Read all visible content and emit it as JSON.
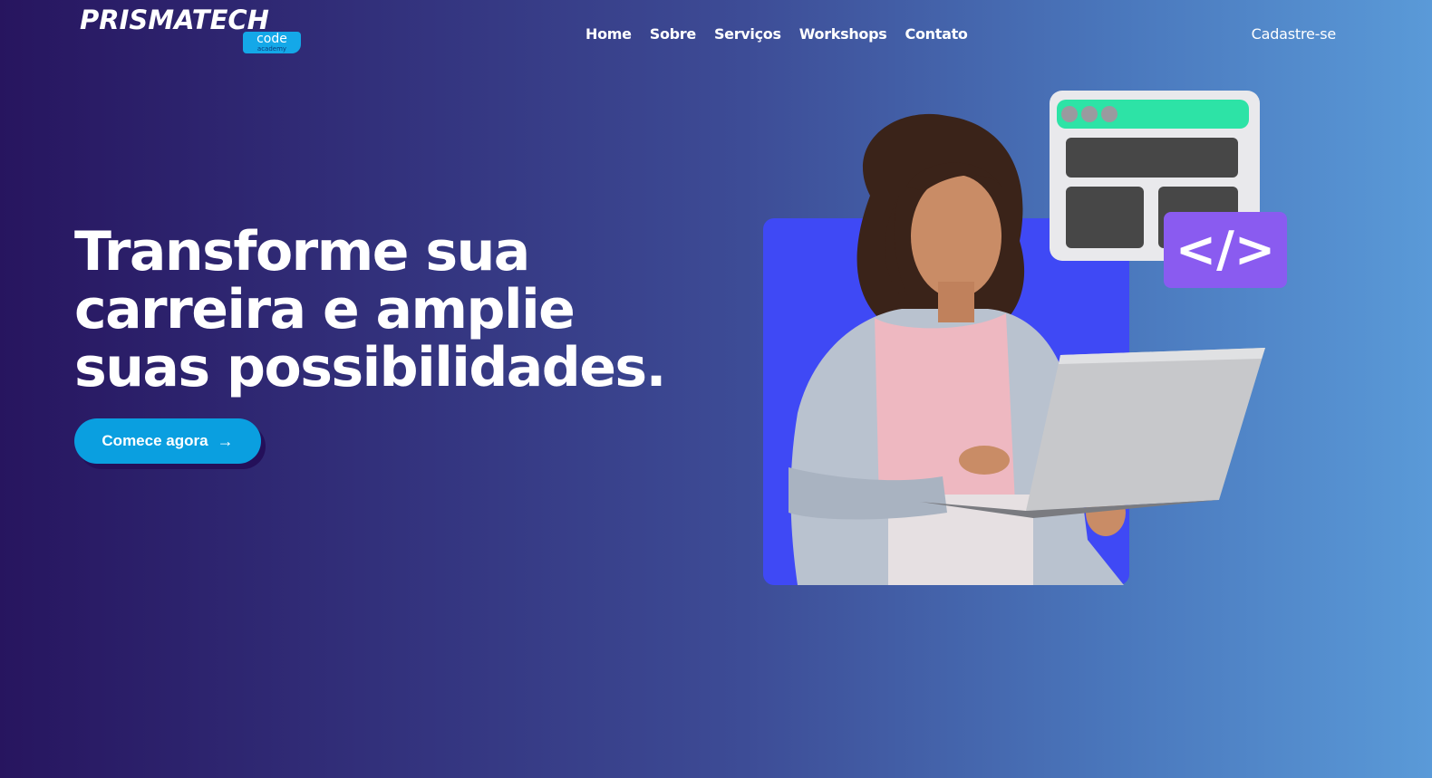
{
  "header": {
    "logo": {
      "word": "PRISMATECH",
      "badge": "code",
      "sub": "academy"
    },
    "nav": [
      {
        "label": "Home"
      },
      {
        "label": "Sobre"
      },
      {
        "label": "Serviços"
      },
      {
        "label": "Workshops"
      },
      {
        "label": "Contato"
      }
    ],
    "signup_label": "Cadastre-se"
  },
  "hero": {
    "title_lines": [
      "Transforme sua",
      "carreira e amplie",
      "suas possibilidades."
    ],
    "cta_label": "Comece agora",
    "cta_icon": "arrow-right-icon",
    "code_symbol": "</>"
  },
  "colors": {
    "gradient_start": "#27155f",
    "gradient_end": "#5a9ad8",
    "cta": "#0a9fe0",
    "accent_blue": "#3f49f5",
    "window_bar": "#2de3a6",
    "code_badge": "#8a5bf0"
  }
}
